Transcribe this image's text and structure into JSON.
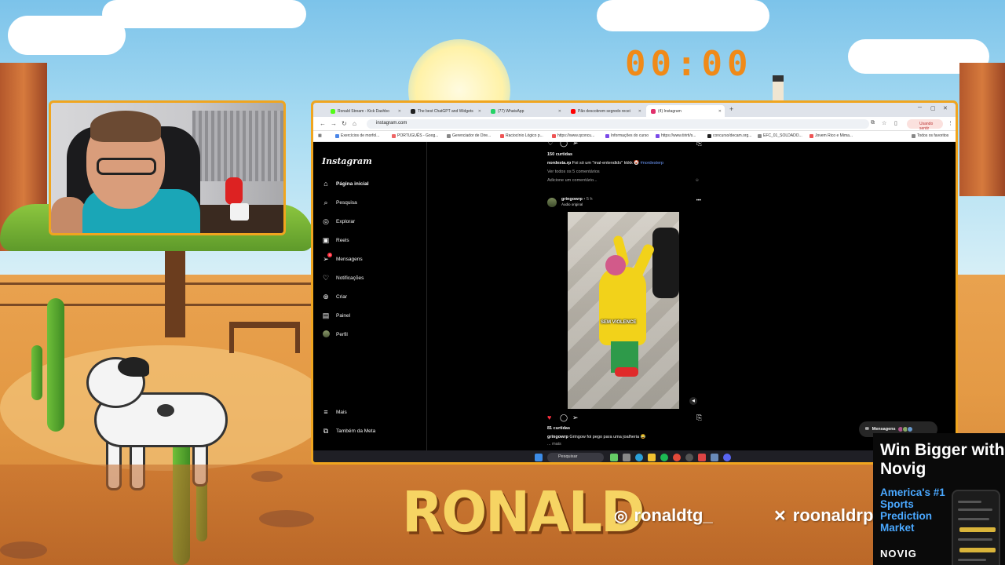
{
  "overlay": {
    "timer": "00:00",
    "brand": "RONALD",
    "instagram_handle": "ronaldtg_",
    "x_handle": "roonaldrp",
    "colors": {
      "accent": "#f0a51f",
      "timer": "#f08a18",
      "brand": "#f6d463"
    }
  },
  "browser": {
    "tabs": [
      {
        "label": "Ronald Stream - Kick Dashbo",
        "favicon_color": "#53fc18"
      },
      {
        "label": "The best ChatGPT and Widgets",
        "favicon_color": "#222222"
      },
      {
        "label": "(77) WhatsApp",
        "favicon_color": "#25d366"
      },
      {
        "label": "Pão descobrem segredo recei",
        "favicon_color": "#ff0000"
      },
      {
        "label": "(4) Instagram",
        "favicon_color": "#e1306c",
        "active": true
      }
    ],
    "url": "instagram.com",
    "stop_button": "Usando sentir",
    "bookmarks": [
      "Exercícios de morfol...",
      "PORTUGUÊS - Goog...",
      "Gerenciador de Dire...",
      "Raciocínio Lógico p...",
      "https://www.qconcu...",
      "Informações do curso",
      "https://www.tirirti/s...",
      "concurso/decam.org...",
      "EFC_01_SOLDADO...",
      "Jovem Rico e Mima...",
      "Todos os favoritos"
    ]
  },
  "instagram": {
    "logo": "Instagram",
    "nav": [
      {
        "label": "Página inicial",
        "icon": "home-icon",
        "glyph": "⌂"
      },
      {
        "label": "Pesquisa",
        "icon": "search-icon",
        "glyph": "⌕"
      },
      {
        "label": "Explorar",
        "icon": "compass-icon",
        "glyph": "◎"
      },
      {
        "label": "Reels",
        "icon": "reels-icon",
        "glyph": "▣"
      },
      {
        "label": "Mensagens",
        "icon": "messages-icon",
        "glyph": "➢",
        "badge": "4"
      },
      {
        "label": "Notificações",
        "icon": "heart-icon",
        "glyph": "♡"
      },
      {
        "label": "Criar",
        "icon": "plus-icon",
        "glyph": "⊕"
      },
      {
        "label": "Painel",
        "icon": "dashboard-icon",
        "glyph": "▤"
      },
      {
        "label": "Perfil",
        "icon": "avatar",
        "glyph": ""
      }
    ],
    "nav_bottom": [
      {
        "label": "Mais",
        "icon": "menu-icon",
        "glyph": "≡"
      },
      {
        "label": "Também da Meta",
        "icon": "meta-icon",
        "glyph": "⧉"
      }
    ],
    "prev_post": {
      "likes": "150 curtidas",
      "caption_user": "nordesta.rp",
      "caption_text": "Foi só um \"mal-entendido\" kkkk 🤡",
      "hashtag": "#nordesterp",
      "comments_link": "Ver todos os 5 comentários",
      "comment_placeholder": "Adicione um comentário..."
    },
    "post": {
      "user": "gringowrp",
      "time": "• 5 h",
      "audio": "Áudio original",
      "sticker": "SEM VIOLENCE",
      "likes": "81 curtidas",
      "caption_user": "gringowrp",
      "caption_text": "Gringow foi pego para uma joalheria 😂",
      "more": "... mais"
    },
    "messages_pill": "Mensagens"
  },
  "taskbar": {
    "search_placeholder": "Pesquisar"
  },
  "ad": {
    "title": "Win Bigger with Novig",
    "subtitle": "America's #1 Sports Prediction Market",
    "logo": "NOVIG",
    "colors": {
      "subtitle": "#4aa8ff"
    }
  }
}
